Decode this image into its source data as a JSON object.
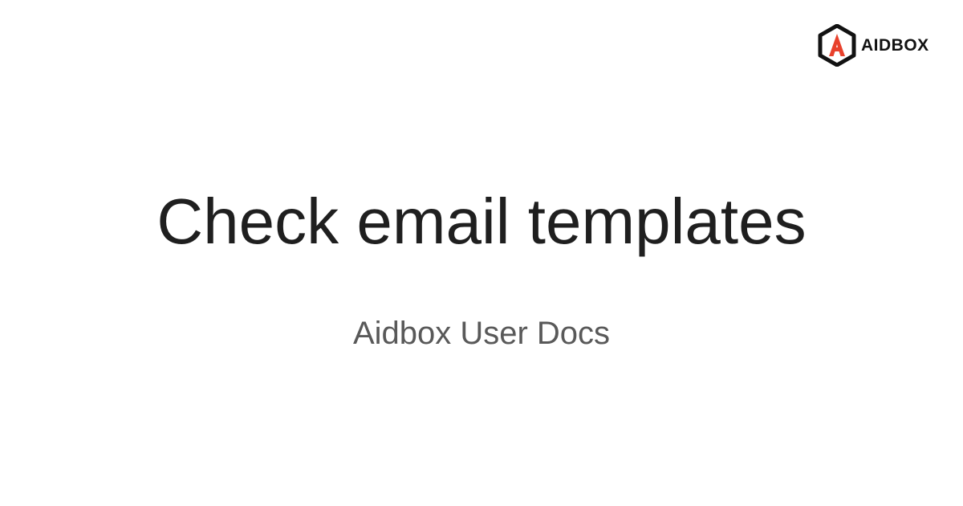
{
  "brand": {
    "logo_letter": "A",
    "logo_text": "AIDBOX",
    "accent_color": "#e8412c",
    "icon": "aidbox-hexagon-logo-icon"
  },
  "page": {
    "title": "Check email templates",
    "subtitle": "Aidbox User Docs"
  }
}
